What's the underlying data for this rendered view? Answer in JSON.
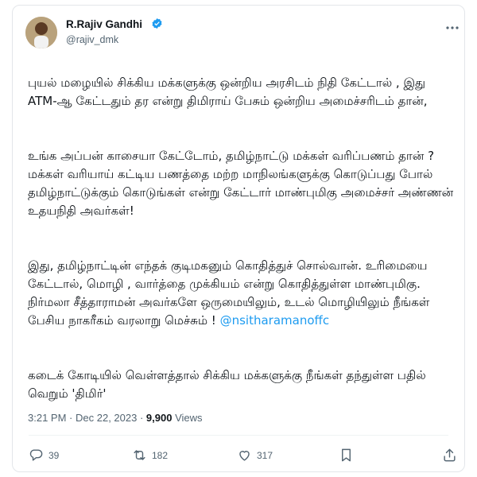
{
  "author": {
    "name": "R.Rajiv Gandhi",
    "handle": "@rajiv_dmk",
    "verified": true,
    "avatar_icon": "profile-photo-icon"
  },
  "tweet": {
    "paragraphs": [
      "புயல் மழையில் சிக்கிய மக்களுக்கு ஒன்றிய அரசிடம் நிதி கேட்டால் , இது ATM-ஆ கேட்டதும் தர என்று திமிராய் பேசும் ஒன்றிய அமைச்சரிடம் தான்,",
      "உங்க அப்பன் காசையா கேட்டோம், தமிழ்நாட்டு மக்கள் வரிப்பணம் தான் ? மக்கள் வரியாய் கட்டிய பணத்தை மற்ற மாநிலங்களுக்கு கொடுப்பது போல் தமிழ்நாட்டுக்கும் கொடுங்கள் என்று கேட்டார் மாண்புமிகு அமைச்சர் அண்ணன் உதயநிதி அவர்கள்!",
      "இது, தமிழ்நாட்டின் எந்தக் குடிமகனும் கொதித்துச் சொல்வான். உரிமையை கேட்டால், மொழி , வார்த்தை முக்கியம் என்று கொதித்துள்ள மாண்புமிகு. நிர்மலா சீத்தாராமன் அவர்களே ஒருமையிலும், உடல் மொழியிலும் நீங்கள் பேசிய நாகரீகம் வரலாறு மெச்சும் !",
      "கடைக் கோடியில் வெள்ளத்தால் சிக்கிய மக்களுக்கு நீங்கள் தந்துள்ள பதில் வெறும் 'திமிர்'"
    ],
    "mention": "@nsitharamanoffc",
    "time": "3:21 PM",
    "date": "Dec 22, 2023",
    "views_count": "9,900",
    "views_label": "Views"
  },
  "actions": {
    "replies": "39",
    "retweets": "182",
    "likes": "317"
  },
  "colors": {
    "accent": "#1d9bf0",
    "text": "#0f1419",
    "muted": "#536471"
  }
}
